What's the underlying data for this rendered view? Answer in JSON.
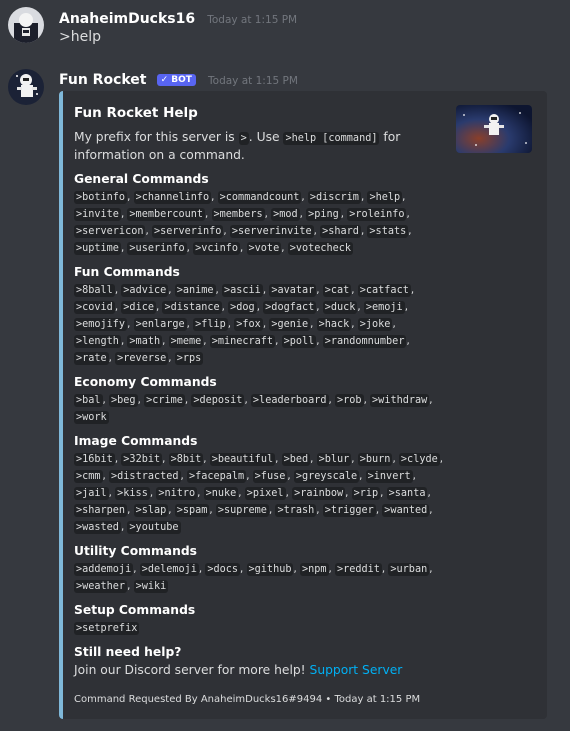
{
  "messages": [
    {
      "author": "AnaheimDucks16",
      "timestamp": "Today at 1:15 PM",
      "content": ">help"
    },
    {
      "author": "Fun Rocket",
      "bot_tag": "✓ BOT",
      "timestamp": "Today at 1:15 PM"
    }
  ],
  "embed": {
    "accent_color": "#7fb8d9",
    "title": "Fun Rocket Help",
    "desc_part1": "My prefix for this server is ",
    "desc_prefix": ">",
    "desc_part2": ". Use ",
    "desc_help": ">help [command]",
    "desc_part3": " for information on a command.",
    "fields": [
      {
        "name": "General Commands",
        "commands": [
          ">botinfo",
          ">channelinfo",
          ">commandcount",
          ">discrim",
          ">help",
          ">invite",
          ">membercount",
          ">members",
          ">mod",
          ">ping",
          ">roleinfo",
          ">servericon",
          ">serverinfo",
          ">serverinvite",
          ">shard",
          ">stats",
          ">uptime",
          ">userinfo",
          ">vcinfo",
          ">vote",
          ">votecheck"
        ]
      },
      {
        "name": "Fun Commands",
        "commands": [
          ">8ball",
          ">advice",
          ">anime",
          ">ascii",
          ">avatar",
          ">cat",
          ">catfact",
          ">covid",
          ">dice",
          ">distance",
          ">dog",
          ">dogfact",
          ">duck",
          ">emoji",
          ">emojify",
          ">enlarge",
          ">flip",
          ">fox",
          ">genie",
          ">hack",
          ">joke",
          ">length",
          ">math",
          ">meme",
          ">minecraft",
          ">poll",
          ">randomnumber",
          ">rate",
          ">reverse",
          ">rps"
        ]
      },
      {
        "name": "Economy Commands",
        "commands": [
          ">bal",
          ">beg",
          ">crime",
          ">deposit",
          ">leaderboard",
          ">rob",
          ">withdraw",
          ">work"
        ]
      },
      {
        "name": "Image Commands",
        "commands": [
          ">16bit",
          ">32bit",
          ">8bit",
          ">beautiful",
          ">bed",
          ">blur",
          ">burn",
          ">clyde",
          ">cmm",
          ">distracted",
          ">facepalm",
          ">fuse",
          ">greyscale",
          ">invert",
          ">jail",
          ">kiss",
          ">nitro",
          ">nuke",
          ">pixel",
          ">rainbow",
          ">rip",
          ">santa",
          ">sharpen",
          ">slap",
          ">spam",
          ">supreme",
          ">trash",
          ">trigger",
          ">wanted",
          ">wasted",
          ">youtube"
        ]
      },
      {
        "name": "Utility Commands",
        "commands": [
          ">addemoji",
          ">delemoji",
          ">docs",
          ">github",
          ">npm",
          ">reddit",
          ">urban",
          ">weather",
          ">wiki"
        ]
      },
      {
        "name": "Setup Commands",
        "commands": [
          ">setprefix"
        ]
      }
    ],
    "need_help_title": "Still need help?",
    "need_help_text": "Join our Discord server for more help! ",
    "support_link": "Support Server",
    "footer": "Command Requested By AnaheimDucks16#9494 • Today at 1:15 PM"
  }
}
